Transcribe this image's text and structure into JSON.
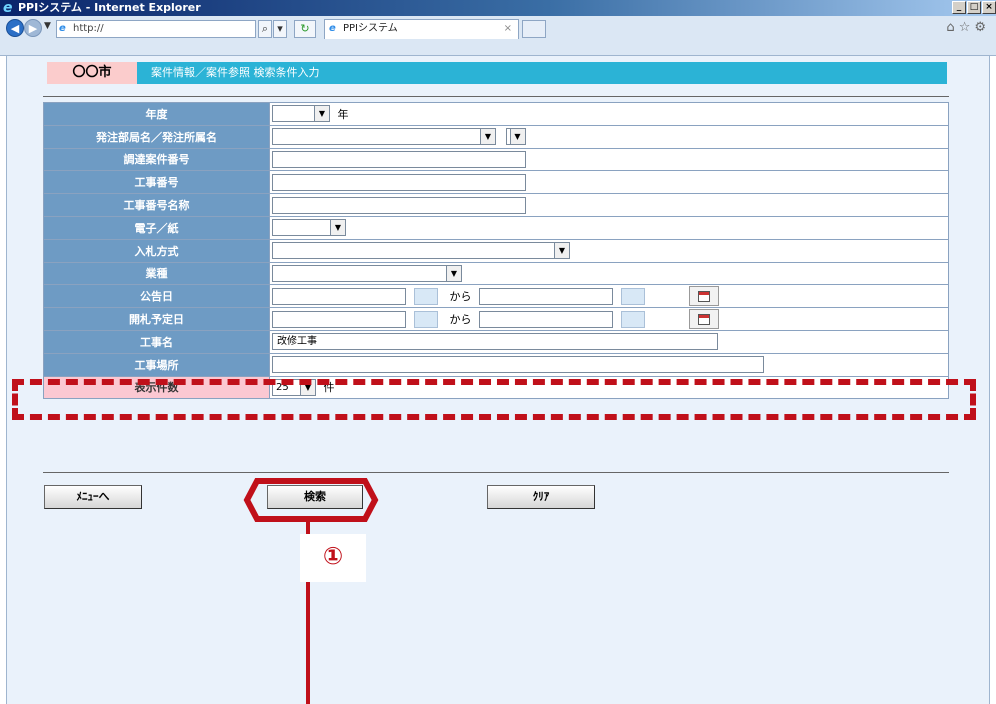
{
  "window": {
    "title": "PPIシステム - Internet Explorer",
    "url": "http://",
    "tab_title": "PPIシステム",
    "buttons": [
      "_",
      "□",
      "×"
    ]
  },
  "header": {
    "city": "〇〇市",
    "breadcrumb": "案件情報／案件参照 検索条件入力"
  },
  "form": {
    "rows": [
      {
        "label": "年度",
        "suffix": "年"
      },
      {
        "label": "発注部局名／発注所属名"
      },
      {
        "label": "調達案件番号"
      },
      {
        "label": "工事番号"
      },
      {
        "label": "工事番号名称"
      },
      {
        "label": "電子／紙"
      },
      {
        "label": "入札方式"
      },
      {
        "label": "業種"
      },
      {
        "label": "公告日",
        "between": "から"
      },
      {
        "label": "開札予定日",
        "between": "から"
      },
      {
        "label": "工事名",
        "value": "改修工事"
      },
      {
        "label": "工事場所"
      },
      {
        "label": "表示件数",
        "value": "25",
        "suffix": "件"
      }
    ]
  },
  "buttons": {
    "menu": "ﾒﾆｭｰへ",
    "search": "検索",
    "clear": "ｸﾘｱ"
  },
  "annotation": {
    "marker": "①",
    "color": "#c0101a"
  }
}
